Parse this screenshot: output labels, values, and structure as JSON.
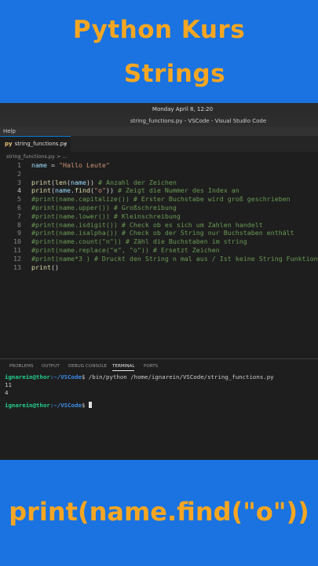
{
  "banner": {
    "title_line1": "Python Kurs",
    "title_line2": "Strings",
    "bottom_text": "print(name.find(\"o\"))"
  },
  "window": {
    "clock": "Monday April 8, 12:20",
    "title": "string_functions.py - VSCode - Visual Studio Code",
    "menu_help": "Help"
  },
  "editor": {
    "tab_icon": "py",
    "tab_label": "string_functions.py",
    "tab_close": "×",
    "breadcrumb": "string_functions.py > ...",
    "current_line": 4,
    "lines": [
      {
        "num": "1",
        "text": "name = \"Hallo Leute\""
      },
      {
        "num": "2",
        "text": ""
      },
      {
        "num": "3",
        "text": "print(len(name)) # Anzahl der Zeichen"
      },
      {
        "num": "4",
        "text": "print(name.find(\"o\")) # Zeigt die Nummer des Index an"
      },
      {
        "num": "5",
        "text": "#print(name.capitalize()) # Erster Buchstabe wird groß geschrieben"
      },
      {
        "num": "6",
        "text": "#print(name.upper()) # Großschreibung"
      },
      {
        "num": "7",
        "text": "#print(name.lower()) # Kleinschreibung"
      },
      {
        "num": "8",
        "text": "#print(name.isdigit()) # Check ob es sich um Zahlen handelt"
      },
      {
        "num": "9",
        "text": "#print(name.isalpha()) # Check ob der String nur Buchstaben enthält"
      },
      {
        "num": "10",
        "text": "#print(name.count(\"n\")) # Zähl die Buchstaben im string"
      },
      {
        "num": "11",
        "text": "#print(name.replace(\"e\", \"o\")) # Ersetzt Zeichen"
      },
      {
        "num": "12",
        "text": "#print(name*3 ) # Druckt den String n mal aus / Ist keine String Funktion"
      },
      {
        "num": "13",
        "text": "print()"
      }
    ]
  },
  "panel": {
    "tabs": [
      "PROBLEMS",
      "OUTPUT",
      "DEBUG CONSOLE",
      "TERMINAL",
      "PORTS"
    ],
    "active_tab": "TERMINAL",
    "prompt_user": "ignarein@thor",
    "prompt_path": ":~/VSCode",
    "prompt_symbol": "$",
    "command": " /bin/python /home/ignarein/VSCode/string_functions.py",
    "output": [
      "11",
      "4"
    ]
  },
  "colors": {
    "background": "#1a73e0",
    "banner_text": "#f5a623",
    "editor_bg": "#1e1e1e",
    "comment": "#6a9955",
    "string": "#ce9178"
  }
}
